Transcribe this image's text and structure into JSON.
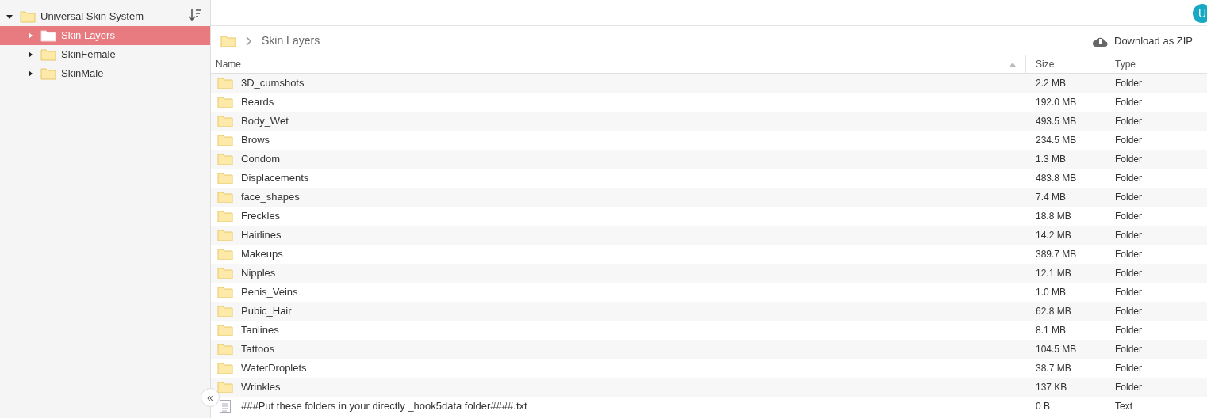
{
  "sidebar": {
    "tree": [
      {
        "label": "Universal Skin System",
        "expanded": true,
        "selected": false,
        "children": [
          {
            "label": "Skin Layers",
            "expanded": false,
            "selected": true
          },
          {
            "label": "SkinFemale",
            "expanded": false,
            "selected": false
          },
          {
            "label": "SkinMale",
            "expanded": false,
            "selected": false
          }
        ]
      }
    ],
    "collapse_button": "«"
  },
  "top_bar": {
    "avatar": "U"
  },
  "breadcrumb": [
    "Skin Layers"
  ],
  "download": "Download as ZIP",
  "table": {
    "columns": [
      {
        "label": "Name",
        "sorted": true
      },
      {
        "label": "Size",
        "sorted": false
      },
      {
        "label": "Type",
        "sorted": false
      }
    ],
    "rows": [
      {
        "kind": "folder",
        "name": "3D_cumshots",
        "size": "2.2 MB",
        "type": "Folder"
      },
      {
        "kind": "folder",
        "name": "Beards",
        "size": "192.0 MB",
        "type": "Folder"
      },
      {
        "kind": "folder",
        "name": "Body_Wet",
        "size": "493.5 MB",
        "type": "Folder"
      },
      {
        "kind": "folder",
        "name": "Brows",
        "size": "234.5 MB",
        "type": "Folder"
      },
      {
        "kind": "folder",
        "name": "Condom",
        "size": "1.3 MB",
        "type": "Folder"
      },
      {
        "kind": "folder",
        "name": "Displacements",
        "size": "483.8 MB",
        "type": "Folder"
      },
      {
        "kind": "folder",
        "name": "face_shapes",
        "size": "7.4 MB",
        "type": "Folder"
      },
      {
        "kind": "folder",
        "name": "Freckles",
        "size": "18.8 MB",
        "type": "Folder"
      },
      {
        "kind": "folder",
        "name": "Hairlines",
        "size": "14.2 MB",
        "type": "Folder"
      },
      {
        "kind": "folder",
        "name": "Makeups",
        "size": "389.7 MB",
        "type": "Folder"
      },
      {
        "kind": "folder",
        "name": "Nipples",
        "size": "12.1 MB",
        "type": "Folder"
      },
      {
        "kind": "folder",
        "name": "Penis_Veins",
        "size": "1.0 MB",
        "type": "Folder"
      },
      {
        "kind": "folder",
        "name": "Pubic_Hair",
        "size": "62.8 MB",
        "type": "Folder"
      },
      {
        "kind": "folder",
        "name": "Tanlines",
        "size": "8.1 MB",
        "type": "Folder"
      },
      {
        "kind": "folder",
        "name": "Tattoos",
        "size": "104.5 MB",
        "type": "Folder"
      },
      {
        "kind": "folder",
        "name": "WaterDroplets",
        "size": "38.7 MB",
        "type": "Folder"
      },
      {
        "kind": "folder",
        "name": "Wrinkles",
        "size": "137 KB",
        "type": "Folder"
      },
      {
        "kind": "text",
        "name": "###Put these folders in your directly _hook5data folder####.txt",
        "size": "0 B",
        "type": "Text"
      }
    ]
  }
}
